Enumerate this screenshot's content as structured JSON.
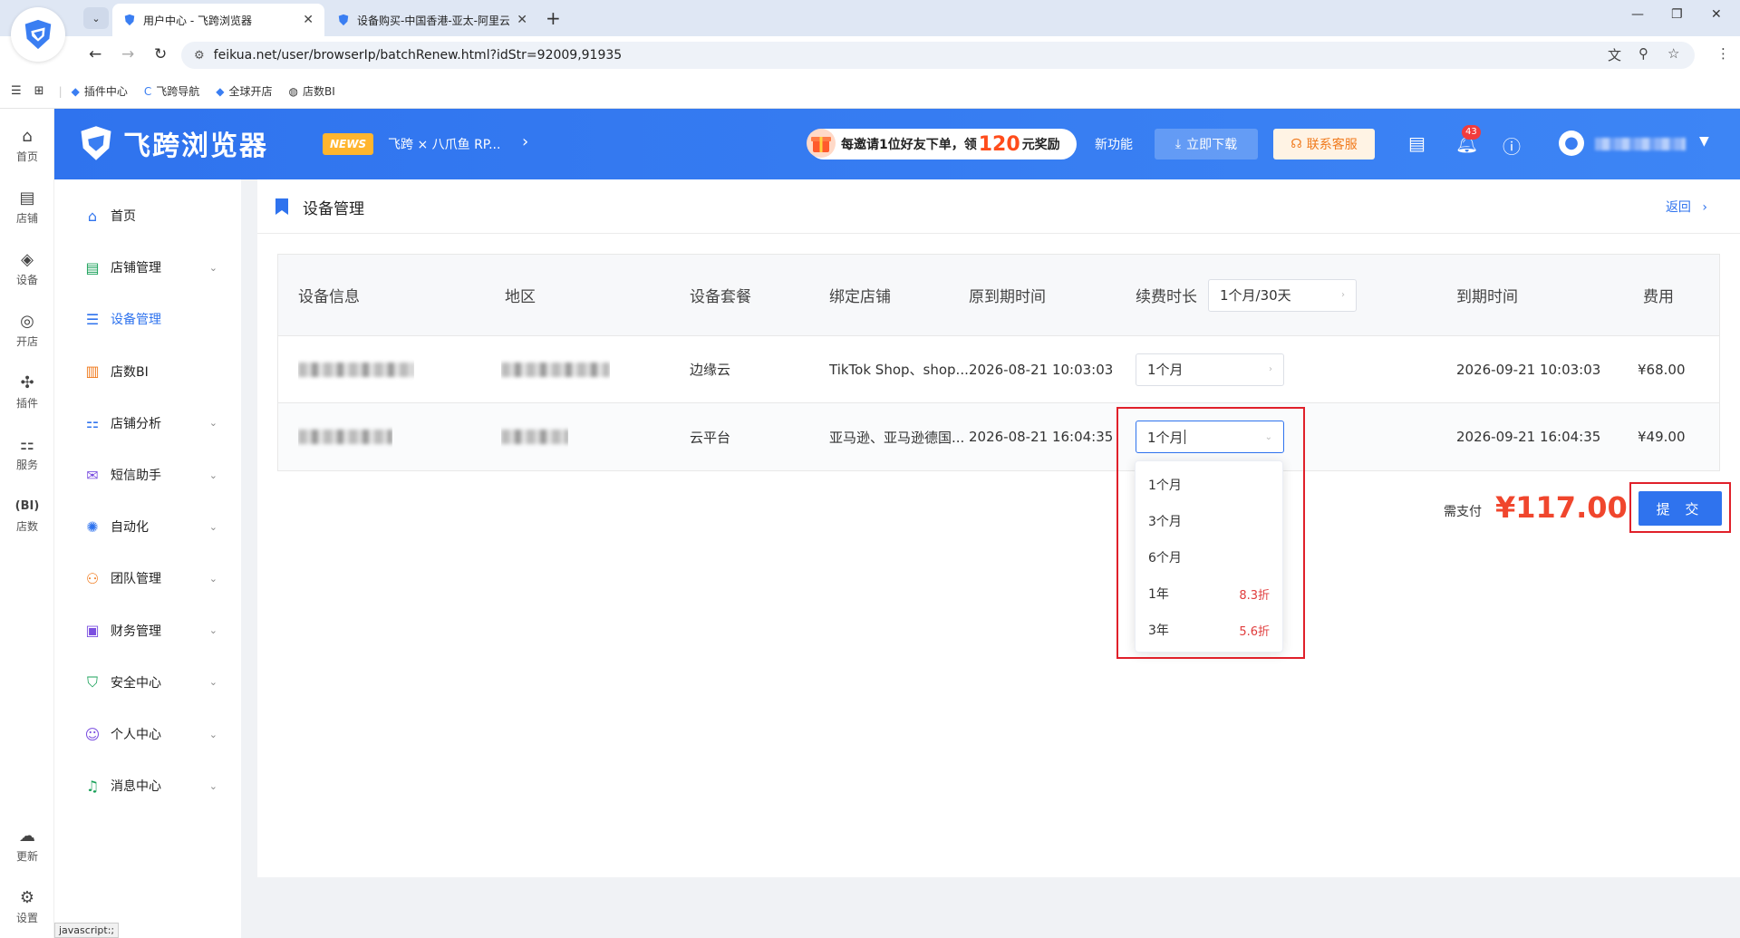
{
  "browser": {
    "tabs": [
      {
        "title": "用户中心 - 飞跨浏览器",
        "active": true
      },
      {
        "title": "设备购买-中国香港-亚太-阿里云",
        "active": false
      }
    ],
    "url": "feikua.net/user/browserIp/batchRenew.html?idStr=92009,91935",
    "bookmarks": [
      "插件中心",
      "飞跨导航",
      "全球开店",
      "店数BI"
    ],
    "status_tip": "javascript:;"
  },
  "rail": {
    "items": [
      {
        "label": "首页",
        "icon": "home-icon"
      },
      {
        "label": "店铺",
        "icon": "store-icon"
      },
      {
        "label": "设备",
        "icon": "layers-icon"
      },
      {
        "label": "开店",
        "icon": "planet-icon"
      },
      {
        "label": "插件",
        "icon": "puzzle-icon"
      },
      {
        "label": "服务",
        "icon": "grid-icon"
      },
      {
        "label": "店数",
        "icon": "bi-icon"
      },
      {
        "label": "更新",
        "icon": "cloud-update-icon"
      },
      {
        "label": "设置",
        "icon": "gear-icon"
      }
    ]
  },
  "header": {
    "brand": "飞跨浏览器",
    "news_badge": "NEWS",
    "news_text": "飞跨 × 八爪鱼 RP...",
    "invite_prefix": "每邀请1位好友下单，领",
    "invite_amount": "120",
    "invite_suffix": "元奖励",
    "new_feature": "新功能",
    "download": "立即下载",
    "contact": "联系客服",
    "bell_count": "43"
  },
  "sidebar": {
    "items": [
      {
        "label": "首页",
        "icon": "home-icon",
        "has_caret": false
      },
      {
        "label": "店铺管理",
        "icon": "store-icon",
        "has_caret": true
      },
      {
        "label": "设备管理",
        "icon": "server-icon",
        "has_caret": false,
        "active": true
      },
      {
        "label": "店数BI",
        "icon": "bar-chart-icon",
        "has_caret": false
      },
      {
        "label": "店铺分析",
        "icon": "grid-icon",
        "has_caret": true
      },
      {
        "label": "短信助手",
        "icon": "message-icon",
        "has_caret": true
      },
      {
        "label": "自动化",
        "icon": "sun-icon",
        "has_caret": true
      },
      {
        "label": "团队管理",
        "icon": "team-icon",
        "has_caret": true
      },
      {
        "label": "财务管理",
        "icon": "wallet-icon",
        "has_caret": true
      },
      {
        "label": "安全中心",
        "icon": "shield-icon",
        "has_caret": true
      },
      {
        "label": "个人中心",
        "icon": "user-icon",
        "has_caret": true
      },
      {
        "label": "消息中心",
        "icon": "bell-icon",
        "has_caret": true
      }
    ]
  },
  "page": {
    "title": "设备管理",
    "back": "返回"
  },
  "table": {
    "headers": {
      "device_info": "设备信息",
      "region": "地区",
      "package": "设备套餐",
      "bound_store": "绑定店铺",
      "orig_expiry": "原到期时间",
      "renew_duration": "续费时长",
      "renew_all_value": "1个月/30天",
      "new_expiry": "到期时间",
      "fee": "费用"
    },
    "rows": [
      {
        "package": "边缘云",
        "store": "TikTok Shop、shop...",
        "orig_expiry": "2026-08-21 10:03:03",
        "duration": "1个月",
        "new_expiry": "2026-09-21 10:03:03",
        "fee": "¥68.00"
      },
      {
        "package": "云平台",
        "store": "亚马逊、亚马逊德国...",
        "orig_expiry": "2026-08-21 16:04:35",
        "duration": "1个月",
        "new_expiry": "2026-09-21 16:04:35",
        "fee": "¥49.00"
      }
    ]
  },
  "dropdown": {
    "options": [
      {
        "label": "1个月",
        "discount": ""
      },
      {
        "label": "3个月",
        "discount": ""
      },
      {
        "label": "6个月",
        "discount": ""
      },
      {
        "label": "1年",
        "discount": "8.3折"
      },
      {
        "label": "3年",
        "discount": "5.6折"
      }
    ]
  },
  "payment": {
    "label": "需支付",
    "amount": "¥117.00",
    "submit": "提 交"
  },
  "colors": {
    "primary": "#2f73ee",
    "price": "#f0462d",
    "highlight_frame": "#e0202a"
  }
}
